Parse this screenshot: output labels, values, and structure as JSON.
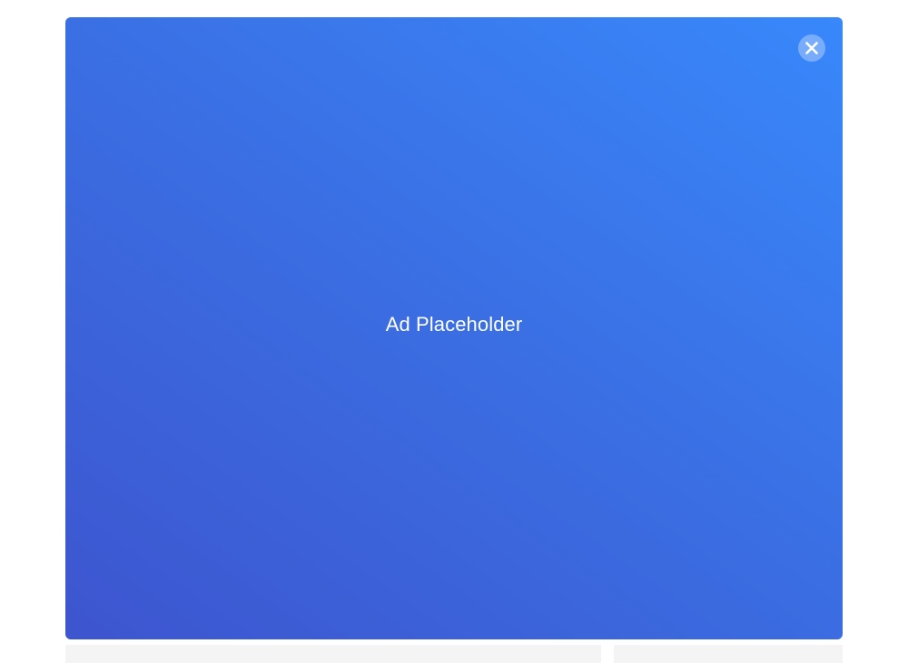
{
  "ad": {
    "label": "Ad Placeholder",
    "close_icon": "close-icon",
    "gradient_colors": [
      "#3d55cf",
      "#3b6be0",
      "#3888fb"
    ]
  },
  "background": {
    "page_color": "#ffffff",
    "card_color": "#f4f4f5"
  }
}
